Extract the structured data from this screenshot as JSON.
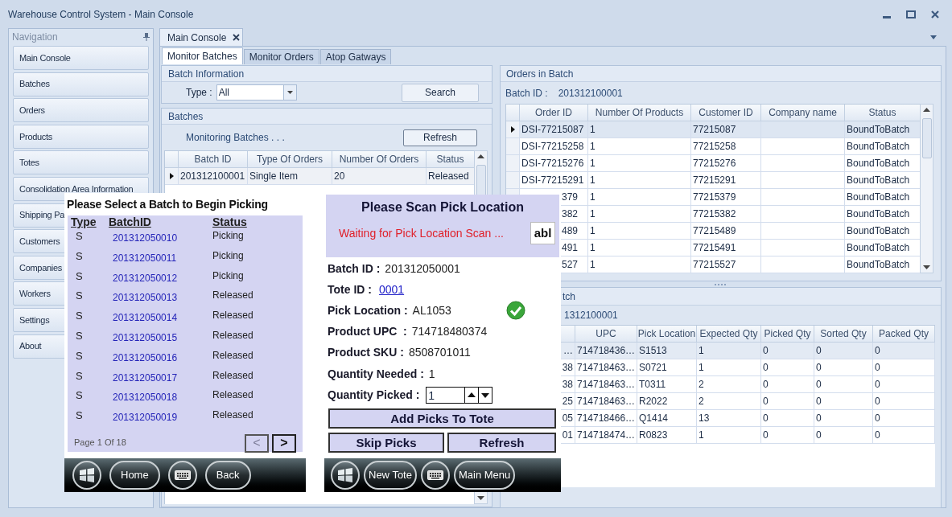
{
  "window": {
    "title": "Warehouse Control System - Main Console"
  },
  "navigation": {
    "title": "Navigation",
    "items": [
      {
        "label": "Main Console"
      },
      {
        "label": "Batches"
      },
      {
        "label": "Orders"
      },
      {
        "label": "Products"
      },
      {
        "label": "Totes"
      },
      {
        "label": "Consolidation Area Information"
      },
      {
        "label": "Shipping Pa"
      },
      {
        "label": "Customers"
      },
      {
        "label": "Companies"
      },
      {
        "label": "Workers"
      },
      {
        "label": "Settings"
      },
      {
        "label": "About"
      }
    ]
  },
  "document_tab": {
    "label": "Main Console"
  },
  "tabs": [
    {
      "label": "Monitor Batches",
      "selected": true
    },
    {
      "label": "Monitor Orders",
      "selected": false
    },
    {
      "label": "Atop Gatways",
      "selected": false
    }
  ],
  "batch_information": {
    "title": "Batch Information",
    "type_label": "Type :",
    "type_value": "All",
    "search_button": "Search"
  },
  "batches": {
    "title": "Batches",
    "status_text": "Monitoring Batches . . .",
    "refresh_button": "Refresh",
    "columns": [
      "Batch ID",
      "Type Of Orders",
      "Number Of Orders",
      "Status"
    ],
    "rows": [
      {
        "current": true,
        "cells": [
          "201312100001",
          "Single Item",
          "20",
          "Released"
        ]
      }
    ]
  },
  "orders_in_batch": {
    "title": "Orders in Batch",
    "batch_id_label": "Batch ID :",
    "batch_id": "201312100001",
    "columns": [
      "Order ID",
      "Number Of Products",
      "Customer ID",
      "Company name",
      "Status"
    ],
    "rows": [
      {
        "current": true,
        "kind": "full",
        "cells": [
          "DSI-77215087",
          "1",
          "77215087",
          "",
          "BoundToBatch"
        ]
      },
      {
        "current": false,
        "kind": "full",
        "cells": [
          "DSI-77215258",
          "1",
          "77215258",
          "",
          "BoundToBatch"
        ]
      },
      {
        "current": false,
        "kind": "full",
        "cells": [
          "DSI-77215276",
          "1",
          "77215276",
          "",
          "BoundToBatch"
        ]
      },
      {
        "current": false,
        "kind": "full",
        "cells": [
          "DSI-77215291",
          "1",
          "77215291",
          "",
          "BoundToBatch"
        ]
      },
      {
        "current": false,
        "kind": "edge",
        "cells": [
          "379",
          "1",
          "77215379",
          "",
          "BoundToBatch"
        ]
      },
      {
        "current": false,
        "kind": "covered",
        "cells": [
          "382",
          "1",
          "77215382",
          "",
          "BoundToBatch"
        ]
      },
      {
        "current": false,
        "kind": "covered",
        "cells": [
          "489",
          "1",
          "77215489",
          "",
          "BoundToBatch"
        ]
      },
      {
        "current": false,
        "kind": "covered",
        "cells": [
          "491",
          "1",
          "77215491",
          "",
          "BoundToBatch"
        ]
      },
      {
        "current": false,
        "kind": "covered",
        "cells": [
          "527",
          "1",
          "77215527",
          "",
          "BoundToBatch"
        ]
      }
    ]
  },
  "products_in_batch": {
    "title": "tch",
    "batch_id": "1312100001",
    "columns": [
      "",
      "UPC",
      "Pick Location",
      "Expected Qty",
      "Picked Qty",
      "Sorted Qty",
      "Packed Qty"
    ],
    "rows": [
      {
        "selected": true,
        "cells": [
          "…",
          "714718436…",
          "S1513",
          "1",
          "0",
          "0",
          "0"
        ]
      },
      {
        "selected": false,
        "cells": [
          "38",
          "714718463…",
          "S0721",
          "1",
          "0",
          "0",
          "0"
        ]
      },
      {
        "selected": false,
        "cells": [
          "38",
          "714718463…",
          "T0311",
          "2",
          "0",
          "0",
          "0"
        ]
      },
      {
        "selected": false,
        "cells": [
          "25",
          "714718463…",
          "R2022",
          "2",
          "0",
          "0",
          "0"
        ]
      },
      {
        "selected": false,
        "cells": [
          "05",
          "714718466…",
          "Q1414",
          "13",
          "0",
          "0",
          "0"
        ]
      },
      {
        "selected": false,
        "cells": [
          "01",
          "714718474…",
          "R0823",
          "1",
          "0",
          "0",
          "0"
        ]
      }
    ]
  },
  "batch_picker": {
    "title": "Please Select a Batch to Begin Picking",
    "columns": [
      "Type",
      "BatchID",
      "Status"
    ],
    "rows": [
      {
        "type": "S",
        "batch_id": "201312050010",
        "status": "Picking"
      },
      {
        "type": "S",
        "batch_id": "201312050011",
        "status": "Picking"
      },
      {
        "type": "S",
        "batch_id": "201312050012",
        "status": "Picking"
      },
      {
        "type": "S",
        "batch_id": "201312050013",
        "status": "Released"
      },
      {
        "type": "S",
        "batch_id": "201312050014",
        "status": "Released"
      },
      {
        "type": "S",
        "batch_id": "201312050015",
        "status": "Released"
      },
      {
        "type": "S",
        "batch_id": "201312050016",
        "status": "Released"
      },
      {
        "type": "S",
        "batch_id": "201312050017",
        "status": "Released"
      },
      {
        "type": "S",
        "batch_id": "201312050018",
        "status": "Released"
      },
      {
        "type": "S",
        "batch_id": "201312050019",
        "status": "Released"
      }
    ],
    "page_text": "Page 1 Of 18",
    "prev": {
      "label": "<",
      "disabled": true
    },
    "next": {
      "label": ">",
      "disabled": false
    },
    "taskbar": [
      {
        "kind": "start"
      },
      {
        "kind": "text",
        "label": "Home"
      },
      {
        "kind": "keyboard"
      },
      {
        "kind": "text",
        "label": "Back"
      }
    ]
  },
  "pick_screen": {
    "title": "Please Scan Pick Location",
    "message": "Waiting for Pick Location Scan ...",
    "scan_button": "abl",
    "fields": [
      {
        "kind": "text",
        "label": "Batch ID :",
        "value": "201312050001"
      },
      {
        "kind": "link",
        "label": "Tote ID :",
        "value": "0001"
      },
      {
        "kind": "verified",
        "label": "Pick Location :",
        "value": "AL1053"
      },
      {
        "kind": "text",
        "label": "Product UPC  :",
        "value": "714718480374"
      },
      {
        "kind": "text",
        "label": "Product SKU :",
        "value": "8508701011"
      },
      {
        "kind": "text",
        "label": "Quantity Needed :",
        "value": "1"
      },
      {
        "kind": "spinner",
        "label": "Quantity Picked :",
        "value": "1"
      }
    ],
    "buttons": [
      "Add Picks To Tote",
      "Skip Picks",
      "Refresh"
    ],
    "taskbar": [
      {
        "kind": "start"
      },
      {
        "kind": "text",
        "label": "New Tote"
      },
      {
        "kind": "keyboard"
      },
      {
        "kind": "text",
        "label": "Main Menu"
      }
    ]
  }
}
